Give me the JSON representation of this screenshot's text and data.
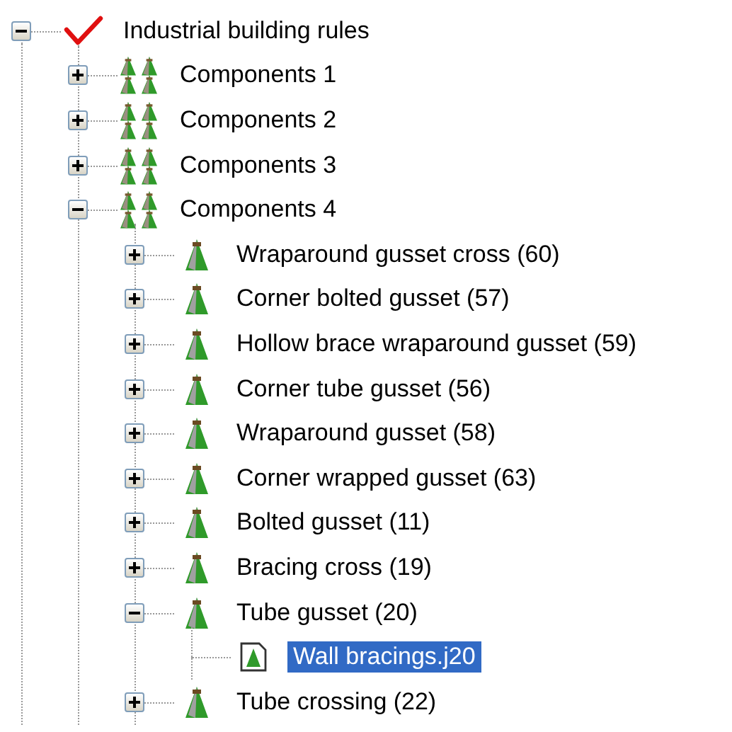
{
  "tree": {
    "label": "Industrial building rules",
    "kind": "rule-set",
    "expanded": true,
    "selected": false,
    "children": [
      {
        "label": "Components 1",
        "kind": "group",
        "expanded": false,
        "selected": false
      },
      {
        "label": "Components 2",
        "kind": "group",
        "expanded": false,
        "selected": false
      },
      {
        "label": "Components 3",
        "kind": "group",
        "expanded": false,
        "selected": false
      },
      {
        "label": "Components 4",
        "kind": "group",
        "expanded": true,
        "selected": false,
        "children": [
          {
            "label": "Wraparound gusset cross (60)",
            "kind": "component",
            "expanded": false,
            "selected": false
          },
          {
            "label": "Corner bolted gusset (57)",
            "kind": "component",
            "expanded": false,
            "selected": false
          },
          {
            "label": "Hollow brace wraparound gusset (59)",
            "kind": "component",
            "expanded": false,
            "selected": false
          },
          {
            "label": "Corner tube gusset (56)",
            "kind": "component",
            "expanded": false,
            "selected": false
          },
          {
            "label": "Wraparound gusset (58)",
            "kind": "component",
            "expanded": false,
            "selected": false
          },
          {
            "label": "Corner wrapped gusset (63)",
            "kind": "component",
            "expanded": false,
            "selected": false
          },
          {
            "label": "Bolted gusset (11)",
            "kind": "component",
            "expanded": false,
            "selected": false
          },
          {
            "label": "Bracing cross (19)",
            "kind": "component",
            "expanded": false,
            "selected": false
          },
          {
            "label": "Tube gusset (20)",
            "kind": "component",
            "expanded": true,
            "selected": false,
            "children": [
              {
                "label": "Wall bracings.j20",
                "kind": "file",
                "selected": true
              }
            ]
          },
          {
            "label": "Tube crossing (22)",
            "kind": "component",
            "expanded": false,
            "selected": false
          }
        ]
      }
    ]
  }
}
